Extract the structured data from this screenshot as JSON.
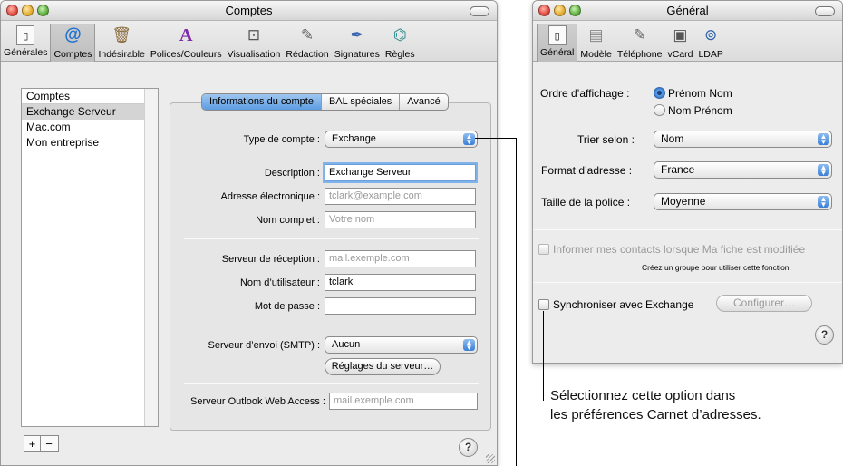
{
  "win1": {
    "title": "Comptes",
    "toolbar": [
      {
        "label": "Générales",
        "icon": "switch-icon"
      },
      {
        "label": "Comptes",
        "icon": "at-icon"
      },
      {
        "label": "Indésirable",
        "icon": "junk-icon"
      },
      {
        "label": "Polices/Couleurs",
        "icon": "font-icon"
      },
      {
        "label": "Visualisation",
        "icon": "glasses-icon"
      },
      {
        "label": "Rédaction",
        "icon": "pencil-icon"
      },
      {
        "label": "Signatures",
        "icon": "pen-icon"
      },
      {
        "label": "Règles",
        "icon": "rules-icon"
      }
    ],
    "accounts_header": "Comptes",
    "accounts": [
      "Exchange Serveur",
      "Mac.com",
      "Mon entreprise"
    ],
    "tabs": [
      "Informations du compte",
      "BAL spéciales",
      "Avancé"
    ],
    "type_label": "Type de compte :",
    "type_value": "Exchange",
    "desc_label": "Description :",
    "desc_value": "Exchange Serveur",
    "email_label": "Adresse électronique :",
    "email_placeholder": "tclark@example.com",
    "name_label": "Nom complet :",
    "name_placeholder": "Votre nom",
    "incoming_label": "Serveur de réception :",
    "incoming_placeholder": "mail.exemple.com",
    "user_label": "Nom d’utilisateur :",
    "user_value": "tclark",
    "pass_label": "Mot de passe :",
    "smtp_label": "Serveur d’envoi (SMTP) :",
    "smtp_value": "Aucun",
    "server_settings": "Réglages du serveur…",
    "owa_label": "Serveur Outlook Web Access :",
    "owa_placeholder": "mail.exemple.com",
    "add": "+",
    "remove": "−",
    "help": "?"
  },
  "win2": {
    "title": "Général",
    "toolbar": [
      {
        "label": "Général",
        "icon": "switch-icon"
      },
      {
        "label": "Modèle",
        "icon": "template-icon"
      },
      {
        "label": "Téléphone",
        "icon": "phone-icon"
      },
      {
        "label": "vCard",
        "icon": "vcard-icon"
      },
      {
        "label": "LDAP",
        "icon": "ldap-icon"
      }
    ],
    "order_label": "Ordre d’affichage :",
    "order_opt1": "Prénom Nom",
    "order_opt2": "Nom Prénom",
    "sort_label": "Trier selon :",
    "sort_value": "Nom",
    "format_label": "Format d’adresse :",
    "format_value": "France",
    "size_label": "Taille de la police :",
    "size_value": "Moyenne",
    "inform_label": "Informer mes contacts lorsque Ma fiche est modifiée",
    "inform_note": "Créez un groupe pour utiliser cette fonction.",
    "sync_label": "Synchroniser avec Exchange",
    "configure": "Configurer…",
    "help": "?"
  },
  "caption": {
    "line1": "Sélectionnez cette option dans",
    "line2": "les préférences Carnet d’adresses."
  }
}
